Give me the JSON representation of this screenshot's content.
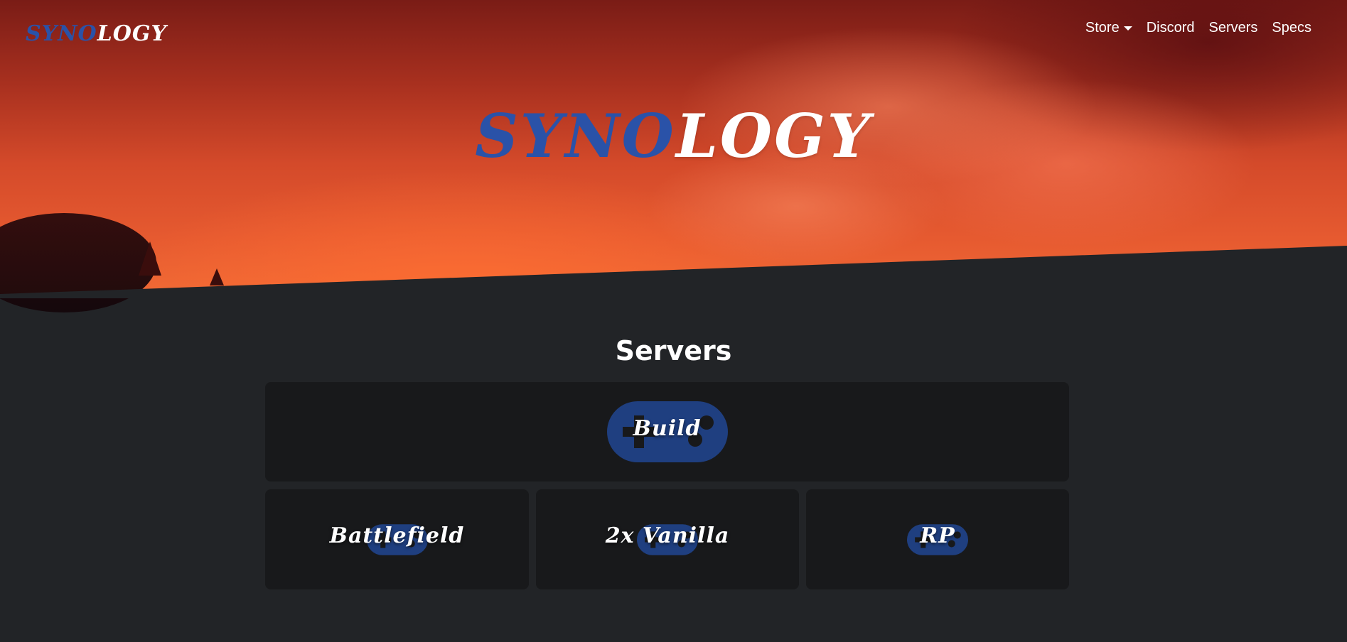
{
  "brand": {
    "part_a": "Syno",
    "part_b": "logy"
  },
  "nav": {
    "items": [
      {
        "label": "Store"
      },
      {
        "label": "Discord"
      },
      {
        "label": "Servers"
      },
      {
        "label": "Specs"
      }
    ]
  },
  "hero": {
    "title_a": "Syno",
    "title_b": "logy"
  },
  "servers": {
    "heading": "Servers",
    "cards": [
      {
        "label": "Build"
      },
      {
        "label": "Battlefield"
      },
      {
        "label": "2x Vanilla"
      },
      {
        "label": "RP"
      }
    ]
  },
  "colors": {
    "accent": "#2a52a8",
    "background": "#222427",
    "card": "#18191b",
    "pad_icon": "#1f3f80"
  },
  "icons": [
    "gamepad-icon",
    "caret-down-icon"
  ]
}
